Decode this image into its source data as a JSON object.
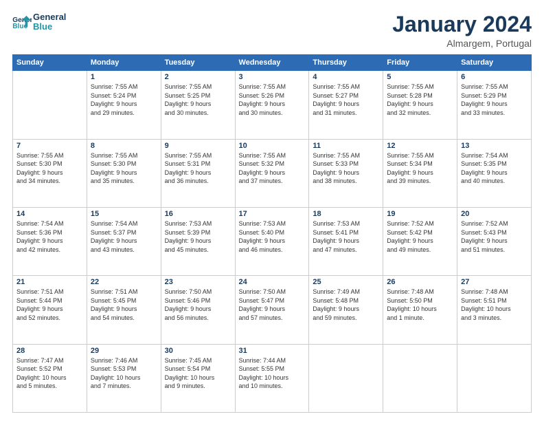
{
  "logo": {
    "line1": "General",
    "line2": "Blue"
  },
  "title": "January 2024",
  "location": "Almargem, Portugal",
  "days_header": [
    "Sunday",
    "Monday",
    "Tuesday",
    "Wednesday",
    "Thursday",
    "Friday",
    "Saturday"
  ],
  "weeks": [
    [
      {
        "day": "",
        "info": ""
      },
      {
        "day": "1",
        "info": "Sunrise: 7:55 AM\nSunset: 5:24 PM\nDaylight: 9 hours\nand 29 minutes."
      },
      {
        "day": "2",
        "info": "Sunrise: 7:55 AM\nSunset: 5:25 PM\nDaylight: 9 hours\nand 30 minutes."
      },
      {
        "day": "3",
        "info": "Sunrise: 7:55 AM\nSunset: 5:26 PM\nDaylight: 9 hours\nand 30 minutes."
      },
      {
        "day": "4",
        "info": "Sunrise: 7:55 AM\nSunset: 5:27 PM\nDaylight: 9 hours\nand 31 minutes."
      },
      {
        "day": "5",
        "info": "Sunrise: 7:55 AM\nSunset: 5:28 PM\nDaylight: 9 hours\nand 32 minutes."
      },
      {
        "day": "6",
        "info": "Sunrise: 7:55 AM\nSunset: 5:29 PM\nDaylight: 9 hours\nand 33 minutes."
      }
    ],
    [
      {
        "day": "7",
        "info": "Sunrise: 7:55 AM\nSunset: 5:30 PM\nDaylight: 9 hours\nand 34 minutes."
      },
      {
        "day": "8",
        "info": "Sunrise: 7:55 AM\nSunset: 5:30 PM\nDaylight: 9 hours\nand 35 minutes."
      },
      {
        "day": "9",
        "info": "Sunrise: 7:55 AM\nSunset: 5:31 PM\nDaylight: 9 hours\nand 36 minutes."
      },
      {
        "day": "10",
        "info": "Sunrise: 7:55 AM\nSunset: 5:32 PM\nDaylight: 9 hours\nand 37 minutes."
      },
      {
        "day": "11",
        "info": "Sunrise: 7:55 AM\nSunset: 5:33 PM\nDaylight: 9 hours\nand 38 minutes."
      },
      {
        "day": "12",
        "info": "Sunrise: 7:55 AM\nSunset: 5:34 PM\nDaylight: 9 hours\nand 39 minutes."
      },
      {
        "day": "13",
        "info": "Sunrise: 7:54 AM\nSunset: 5:35 PM\nDaylight: 9 hours\nand 40 minutes."
      }
    ],
    [
      {
        "day": "14",
        "info": "Sunrise: 7:54 AM\nSunset: 5:36 PM\nDaylight: 9 hours\nand 42 minutes."
      },
      {
        "day": "15",
        "info": "Sunrise: 7:54 AM\nSunset: 5:37 PM\nDaylight: 9 hours\nand 43 minutes."
      },
      {
        "day": "16",
        "info": "Sunrise: 7:53 AM\nSunset: 5:39 PM\nDaylight: 9 hours\nand 45 minutes."
      },
      {
        "day": "17",
        "info": "Sunrise: 7:53 AM\nSunset: 5:40 PM\nDaylight: 9 hours\nand 46 minutes."
      },
      {
        "day": "18",
        "info": "Sunrise: 7:53 AM\nSunset: 5:41 PM\nDaylight: 9 hours\nand 47 minutes."
      },
      {
        "day": "19",
        "info": "Sunrise: 7:52 AM\nSunset: 5:42 PM\nDaylight: 9 hours\nand 49 minutes."
      },
      {
        "day": "20",
        "info": "Sunrise: 7:52 AM\nSunset: 5:43 PM\nDaylight: 9 hours\nand 51 minutes."
      }
    ],
    [
      {
        "day": "21",
        "info": "Sunrise: 7:51 AM\nSunset: 5:44 PM\nDaylight: 9 hours\nand 52 minutes."
      },
      {
        "day": "22",
        "info": "Sunrise: 7:51 AM\nSunset: 5:45 PM\nDaylight: 9 hours\nand 54 minutes."
      },
      {
        "day": "23",
        "info": "Sunrise: 7:50 AM\nSunset: 5:46 PM\nDaylight: 9 hours\nand 56 minutes."
      },
      {
        "day": "24",
        "info": "Sunrise: 7:50 AM\nSunset: 5:47 PM\nDaylight: 9 hours\nand 57 minutes."
      },
      {
        "day": "25",
        "info": "Sunrise: 7:49 AM\nSunset: 5:48 PM\nDaylight: 9 hours\nand 59 minutes."
      },
      {
        "day": "26",
        "info": "Sunrise: 7:48 AM\nSunset: 5:50 PM\nDaylight: 10 hours\nand 1 minute."
      },
      {
        "day": "27",
        "info": "Sunrise: 7:48 AM\nSunset: 5:51 PM\nDaylight: 10 hours\nand 3 minutes."
      }
    ],
    [
      {
        "day": "28",
        "info": "Sunrise: 7:47 AM\nSunset: 5:52 PM\nDaylight: 10 hours\nand 5 minutes."
      },
      {
        "day": "29",
        "info": "Sunrise: 7:46 AM\nSunset: 5:53 PM\nDaylight: 10 hours\nand 7 minutes."
      },
      {
        "day": "30",
        "info": "Sunrise: 7:45 AM\nSunset: 5:54 PM\nDaylight: 10 hours\nand 9 minutes."
      },
      {
        "day": "31",
        "info": "Sunrise: 7:44 AM\nSunset: 5:55 PM\nDaylight: 10 hours\nand 10 minutes."
      },
      {
        "day": "",
        "info": ""
      },
      {
        "day": "",
        "info": ""
      },
      {
        "day": "",
        "info": ""
      }
    ]
  ]
}
